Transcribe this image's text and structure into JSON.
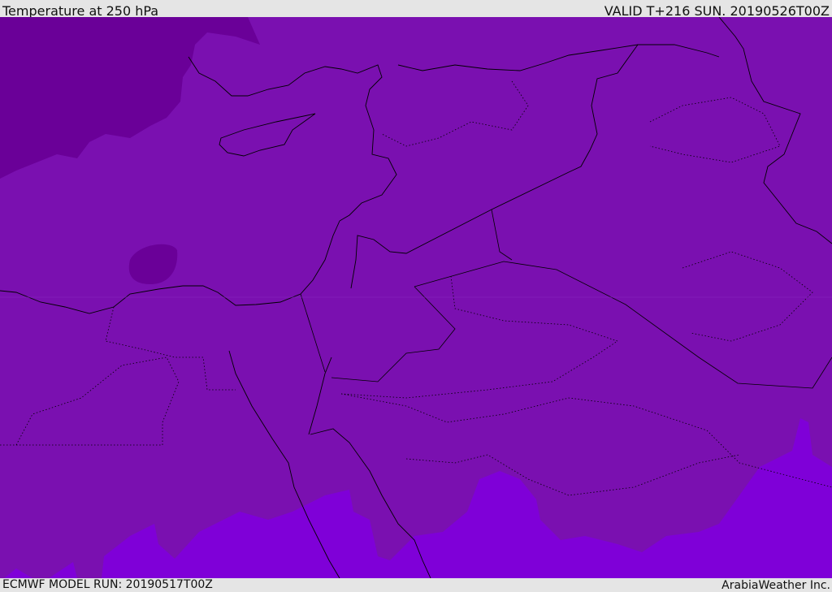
{
  "header": {
    "title": "Temperature at 250 hPa",
    "valid": "VALID T+216 SUN. 20190526T00Z"
  },
  "footer": {
    "model_run": "ECMWF MODEL RUN: 20190517T00Z",
    "credit": "ArabiaWeather Inc."
  },
  "colors": {
    "base": "#7a10b0",
    "cold": "#6a0098",
    "warm": "#7f00d8",
    "line": "#000000"
  }
}
